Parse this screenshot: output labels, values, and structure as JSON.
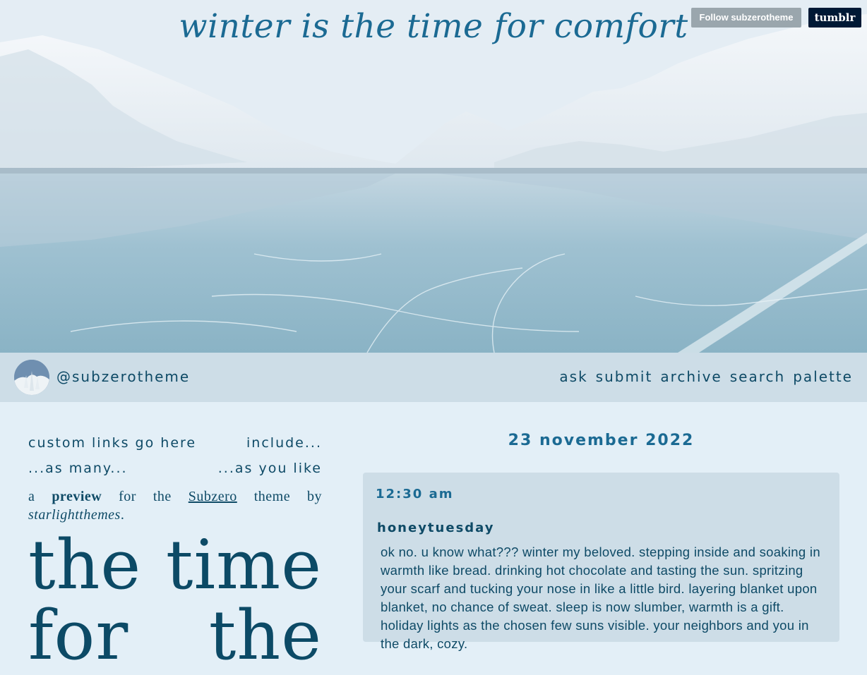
{
  "header": {
    "title": "winter is the time for comfort",
    "follow_label": "Follow subzerotheme",
    "tumblr_label": "tumblr"
  },
  "navbar": {
    "username": "@subzerotheme",
    "links": [
      "ask",
      "submit",
      "archive",
      "search",
      "palette"
    ]
  },
  "sidebar": {
    "custom_links": [
      "custom links go here",
      "include...",
      "...as many...",
      "...as you like"
    ],
    "description": {
      "prefix": "a",
      "bold": "preview",
      "mid": "for the",
      "link": "Subzero",
      "mid2": "theme by",
      "author": "starlightthemes",
      "suffix": "."
    },
    "quote": "the time for the"
  },
  "post": {
    "date": "23 november 2022",
    "time": "12:30 am",
    "author": "honeytuesday",
    "body": "ok no. u know what??? winter my beloved. stepping inside and soaking in warmth like bread. drinking hot chocolate and tasting the sun. spritzing your scarf and tucking your nose in like a little bird. layering blanket upon blanket, no chance of sweat. sleep is now slumber, warmth is a gift. holiday lights as the chosen few suns visible. your neighbors and you in the dark, cozy."
  },
  "colors": {
    "accent": "#1b6a93",
    "text": "#0e4a66",
    "background": "#e3eff7",
    "bar": "#cddde7"
  }
}
